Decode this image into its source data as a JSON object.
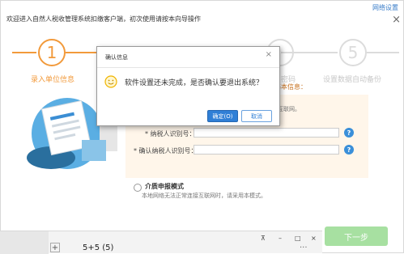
{
  "wizard": {
    "title": "欢迎进入自然人税收管理系统扣缴客户端，初次使用请按本向导操作",
    "net_settings_link": "网络设置",
    "close_glyph": "×"
  },
  "steps": [
    {
      "number": "1",
      "label": "录入单位信息"
    },
    {
      "number": "",
      "label": ""
    },
    {
      "number": "",
      "label": "密码"
    },
    {
      "number": "5",
      "label": "设置数据自动备份"
    }
  ],
  "form": {
    "basic_info_header": "基本信息：",
    "notice": "互联网。",
    "taxpayer_id_label": "* 纳税人识别号：",
    "confirm_taxpayer_id_label": "* 确认纳税人识别号：",
    "help_glyph": "?",
    "paper_mode_title": "介质申报模式",
    "paper_mode_desc": "本地网络无法正常连接互联网时，请采用本模式。"
  },
  "next_button": "下一步",
  "dialog": {
    "title": "确认信息",
    "close_glyph": "×",
    "message": "软件设置还未完成，是否确认要退出系统？",
    "ok_label": "确定(O)",
    "cancel_label": "取消"
  },
  "taskbar": {
    "plus_glyph": "+",
    "expression": "5+5 (5)",
    "pin_glyph": "⊼",
    "min_glyph": "–",
    "max_glyph": "□",
    "close_glyph": "×",
    "more_glyph": "···"
  },
  "colors": {
    "accent_orange": "#f29a3b",
    "step_inactive": "#dcdcdc",
    "dialog_ok_blue": "#2f7fd6",
    "next_green": "#a7e0a1"
  }
}
